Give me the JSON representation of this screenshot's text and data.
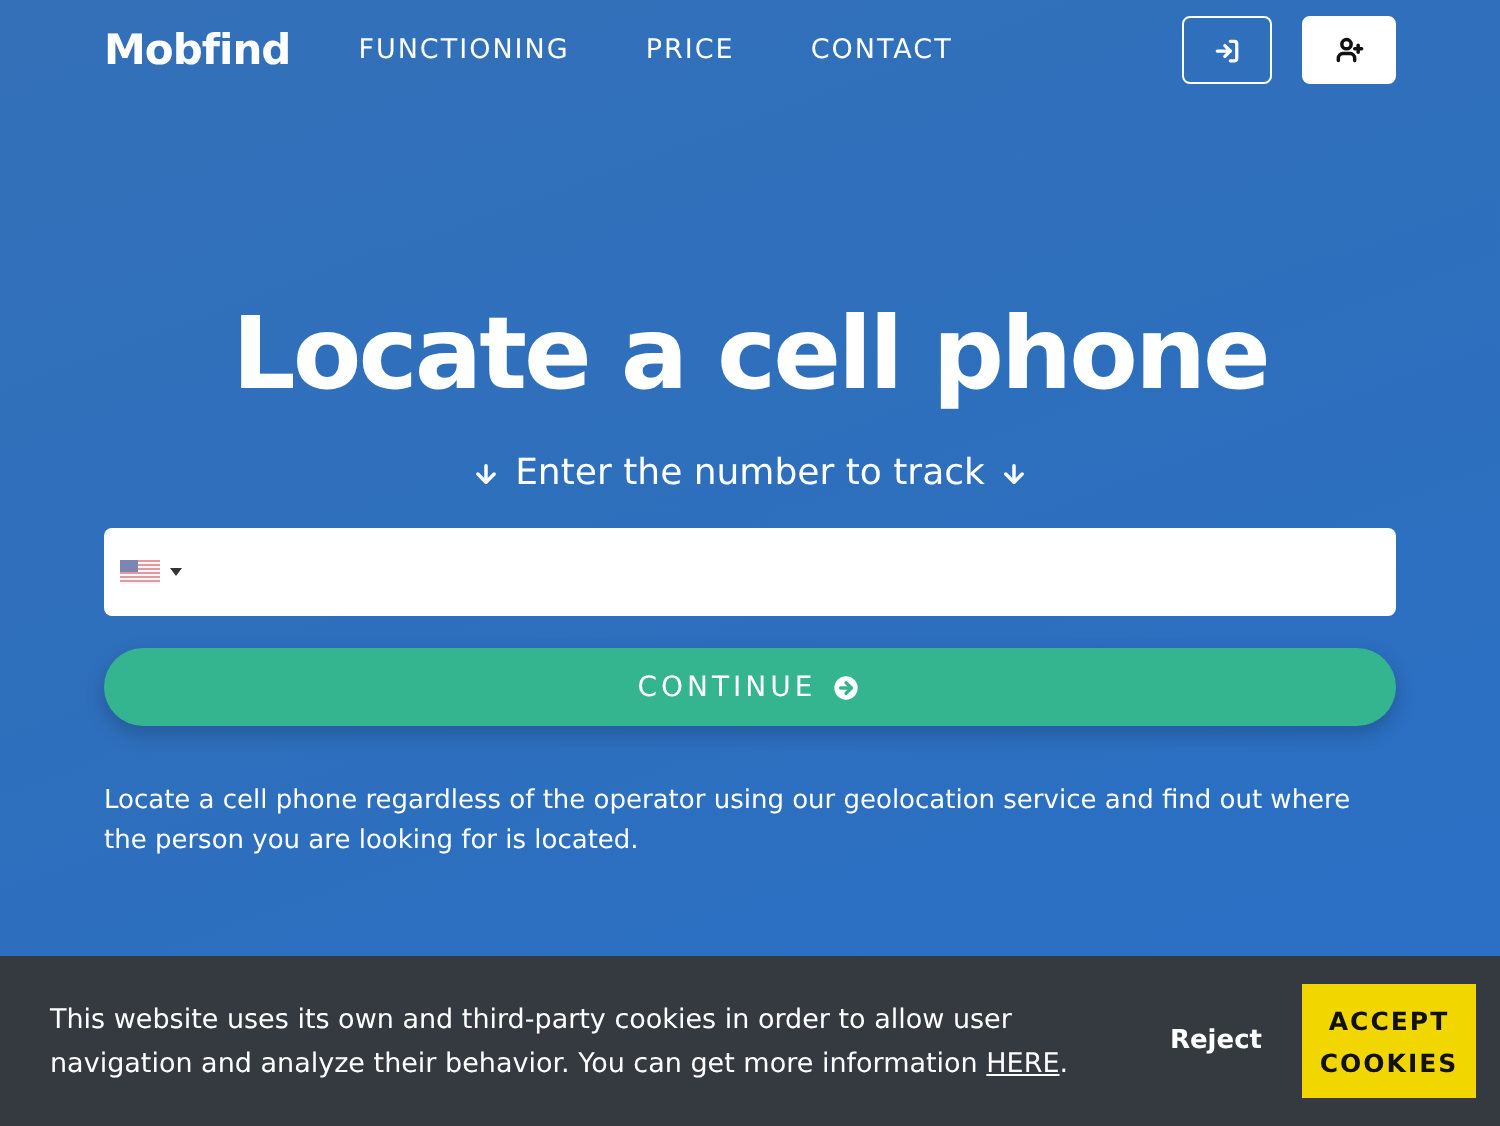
{
  "nav": {
    "logo": "Mobfind",
    "links": [
      "FUNCTIONING",
      "PRICE",
      "CONTACT"
    ]
  },
  "hero": {
    "title": "Locate a cell phone",
    "subtitle": "Enter the number to track",
    "button": "CONTINUE",
    "description": "Locate a cell phone regardless of the operator using our geolocation service and find out where the person you are looking for is located."
  },
  "cookie_bar": {
    "text": "This website uses its own and third-party cookies in order to allow user navigation and analyze their behavior. You can get more information ",
    "link": "HERE",
    "text_end": ".",
    "reject": "Reject",
    "accept": "ACCEPT COOKIES"
  }
}
